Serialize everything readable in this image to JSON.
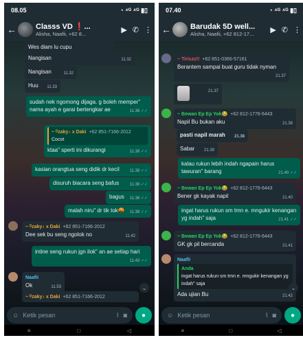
{
  "left": {
    "status": {
      "time": "08.05",
      "icons": "◔ ⁴ᴳ ⁴ᴳ ▮▯"
    },
    "header": {
      "title": "Classs VD ❗...",
      "subtitle": "Alisha, Naafii, +62 8..."
    },
    "messages": {
      "m0": {
        "text": "Wes diam lu cupu"
      },
      "m1": {
        "text": "Nangisan",
        "time": "11.32"
      },
      "m2": {
        "text": "Nangisan",
        "time": "11.32"
      },
      "m3": {
        "text": "Huu",
        "time": "11.33"
      },
      "m4": {
        "text": "sudah nek ngomong dijaga. g boleh memper\" nama ayah e garai bertengkar ae",
        "time": "11.38"
      },
      "m5": {
        "quote_sender": "~ ᴰzaky♪ x Daki",
        "quote_phone": "+62 851-7166-2012",
        "quote_text": "Cocot",
        "text": "ktaa\" sperti ini dikurangi",
        "time": "11.38"
      },
      "m6": {
        "text": "kasian orangtua seng didik dr kecil",
        "time": "11.38"
      },
      "m7": {
        "text": "disuruh biacara seng bafus",
        "time": "11.38"
      },
      "m8": {
        "text": "bagus",
        "time": "11.38"
      },
      "m9": {
        "text": "malah niru\" dr tik tok🤬",
        "time": "11.38"
      },
      "m10": {
        "sender": "~ ᴰzaky♪ x Daki",
        "phone": "+62 851-7166-2012",
        "text": "Dee sek bu seng ngolok no",
        "time": "11.42"
      },
      "m11": {
        "text": "intine seng rukun jgn ilok\" an ae setiap hari",
        "time": "11.43"
      },
      "m12": {
        "sender": "Naafii",
        "text": "Ok",
        "time": "11.53"
      },
      "m13": {
        "sender": "~ ᴰzaky♪ x Daki",
        "phone": "+62 851-7166-2012"
      }
    },
    "input_placeholder": "Ketik pesan"
  },
  "right": {
    "status": {
      "time": "07.40",
      "icons": "◔ ⁴ᴳ ⁴ᴳ ▮▯"
    },
    "header": {
      "title": "Barudak 5D well...",
      "subtitle": "Alisha, Naafii, +62 812-17..."
    },
    "messages": {
      "r1": {
        "sender": "~ Tiriszz!!",
        "phone": "+62 851-0366-57161",
        "text": "Berantem sampai buat guru tidak nyman",
        "time": "21.37"
      },
      "r2": {
        "time": "21.37"
      },
      "r3": {
        "sender": "~ Bewan Ep Ep Yok😂",
        "phone": "+62 812-1776-6443",
        "text": "Napil Bu bukan aku",
        "time": "21.38"
      },
      "r4": {
        "text": "pasti napil marah",
        "time": "21.38"
      },
      "r5": {
        "text": "Sabar",
        "time": "21.39"
      },
      "r6": {
        "text": "kalau rukun lebih indah ngapain harus tawuran\" barang",
        "time": "21.40"
      },
      "r7": {
        "sender": "~ Bewan Ep Ep Yok😂",
        "phone": "+62 812-1776-6443",
        "text": "Bener gk kayak napil",
        "time": "21.40"
      },
      "r8": {
        "text": "ingat harus rukun sm tmn e. mngukir kenangan yg indah\" saja",
        "time": "21.41"
      },
      "r9": {
        "sender": "~ Bewan Ep Ep Yok😂",
        "phone": "+62 812-1776-6443",
        "text": "GK gk pil bercanda",
        "time": "21.41"
      },
      "r10": {
        "sender": "Naafii",
        "quote_sender": "Anda",
        "quote_text": "ingat harus rukun sm tmn e. mngukir kenangan yg indah\" saja",
        "text": "Ada ujian Bu",
        "time": "21.42"
      }
    },
    "input_placeholder": "Ketik pesan"
  },
  "colors": {
    "outgoing": "#005c4b",
    "incoming": "#202c33",
    "header": "#1f2c34",
    "accent": "#00a884",
    "read_tick": "#53bdeb"
  },
  "icons": [
    "back-arrow-icon",
    "video-call-icon",
    "voice-call-icon",
    "more-icon",
    "emoji-icon",
    "attach-icon",
    "camera-icon",
    "mic-icon",
    "chevron-down-icon"
  ]
}
